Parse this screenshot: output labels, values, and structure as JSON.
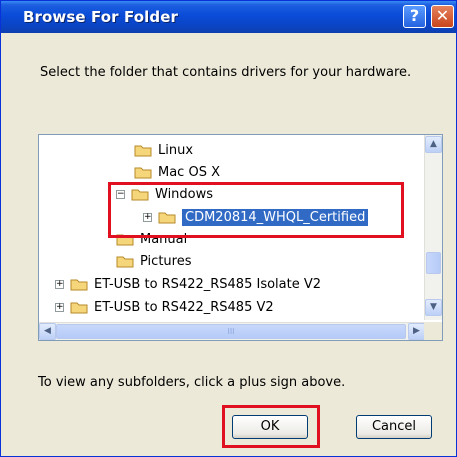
{
  "window": {
    "title": "Browse For Folder",
    "help_glyph": "?",
    "close_glyph": "✕"
  },
  "prompt": "Select the folder that contains drivers for your hardware.",
  "tree": {
    "items": [
      {
        "label": "Linux",
        "expander": ""
      },
      {
        "label": "Mac OS X",
        "expander": ""
      },
      {
        "label": "Windows",
        "expander": "−"
      },
      {
        "label": "CDM20814_WHQL_Certified",
        "expander": "+",
        "selected": true
      },
      {
        "label": "Manual",
        "expander": ""
      },
      {
        "label": "Pictures",
        "expander": ""
      },
      {
        "label": "ET-USB to RS422_RS485 Isolate V2",
        "expander": "+"
      },
      {
        "label": "ET-USB to RS422_RS485 V2",
        "expander": "+"
      }
    ]
  },
  "scroll": {
    "up": "▲",
    "down": "▼",
    "left": "◀",
    "right": "▶",
    "grip": "III"
  },
  "hint": "To view any subfolders, click a plus sign above.",
  "buttons": {
    "ok": "OK",
    "cancel": "Cancel"
  },
  "colors": {
    "title_bar": "#0a4bd8",
    "selection": "#316ac5",
    "highlight_box": "#e01020",
    "folder": "#f6d67a"
  }
}
